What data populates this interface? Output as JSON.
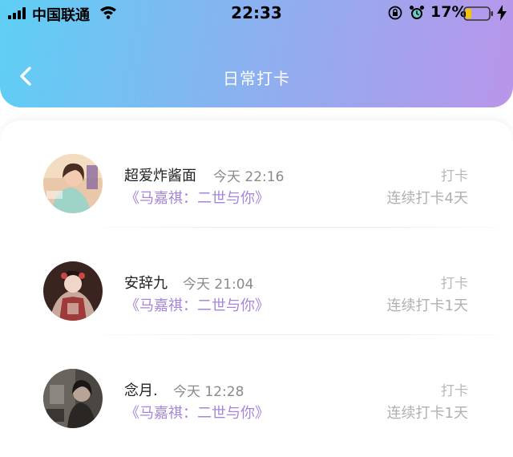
{
  "status_bar": {
    "carrier": "中国联通",
    "time": "22:33",
    "battery_percent": "17%",
    "battery_level": 0.17,
    "icons": [
      "signal-icon",
      "wifi-icon",
      "rotation-lock-icon",
      "alarm-icon",
      "battery-icon",
      "charging-icon"
    ]
  },
  "header": {
    "title": "日常打卡",
    "back_icon": "chevron-left-icon"
  },
  "colors": {
    "gradient_start": "#5ecff5",
    "gradient_end": "#b995ea",
    "book_title": "#a585dd",
    "muted": "#b0b0b0"
  },
  "checkins": [
    {
      "name": "超爱炸酱面",
      "time": "今天 22:16",
      "book": "《马嘉祺：二世与你》",
      "action": "打卡",
      "streak": "连续打卡4天"
    },
    {
      "name": "安辞九",
      "time": "今天 21:04",
      "book": "《马嘉祺：二世与你》",
      "action": "打卡",
      "streak": "连续打卡1天"
    },
    {
      "name": "念月.",
      "time": "今天 12:28",
      "book": "《马嘉祺：二世与你》",
      "action": "打卡",
      "streak": "连续打卡1天"
    }
  ]
}
